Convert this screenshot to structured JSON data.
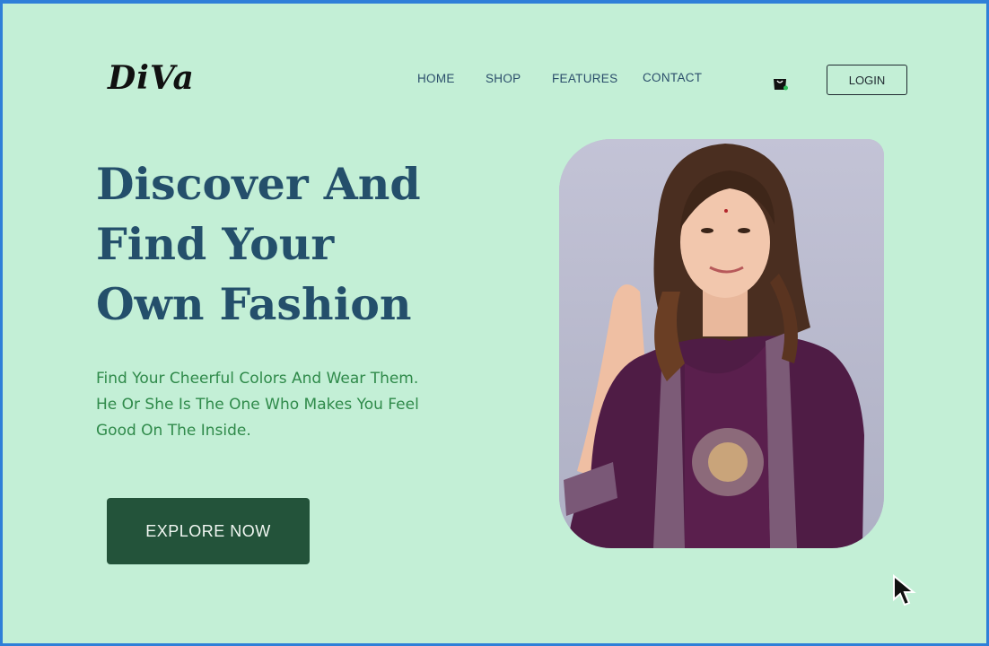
{
  "brand": {
    "logo_text": "DiVa"
  },
  "nav": {
    "items": [
      "HOME",
      "SHOP",
      "FEATURES",
      "CONTACT"
    ]
  },
  "header": {
    "login_label": "LOGIN",
    "cart_icon": "shopping-bag-icon"
  },
  "hero": {
    "headline": [
      "Discover And",
      "Find Your",
      "Own Fashion"
    ],
    "subtext": [
      "Find Your Cheerful Colors And Wear Them.",
      "He Or She Is The One Who Makes You Feel",
      "Good On The Inside."
    ],
    "cta_label": "EXPLORE  NOW"
  },
  "colors": {
    "background": "#c3efd6",
    "headline": "#244f6b",
    "subtext": "#2f8a4a",
    "button": "#23533a",
    "frame": "#2f7fd8"
  }
}
